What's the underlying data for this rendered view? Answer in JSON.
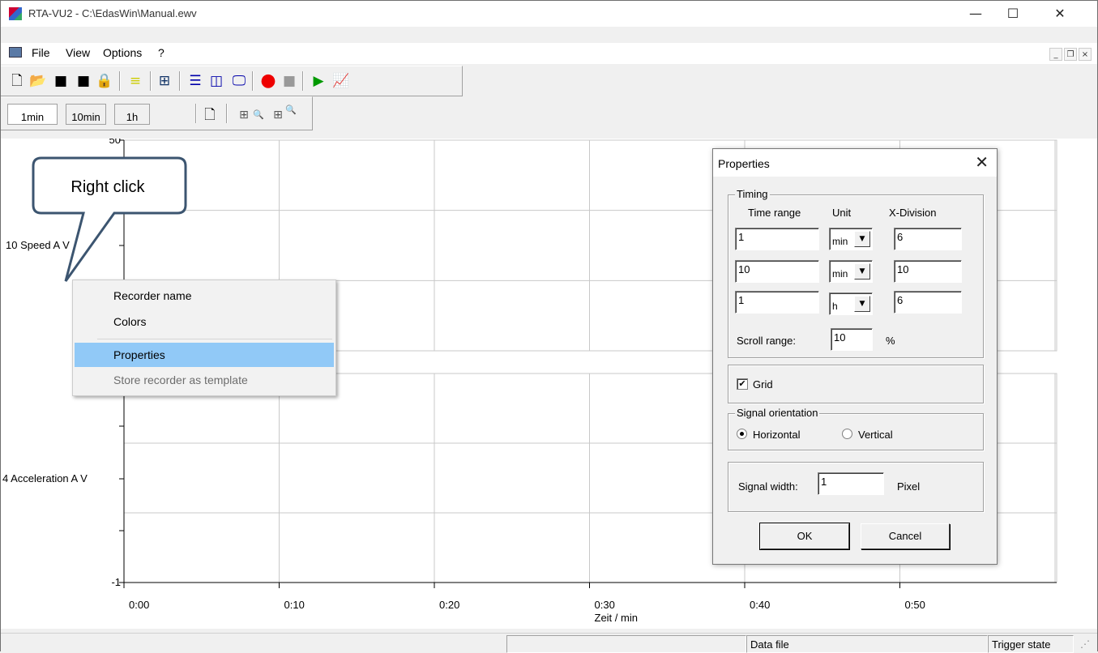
{
  "window": {
    "title": "RTA-VU2 - C:\\EdasWin\\Manual.ewv",
    "minimize": "—",
    "maximize": "☐",
    "close": "✕"
  },
  "menu": {
    "items": [
      "File",
      "View",
      "Options",
      "?"
    ],
    "mdi_minimize": "_",
    "mdi_restore": "❐",
    "mdi_close": "×"
  },
  "toolbar_icons": [
    "new-file-icon",
    "open-folder-icon",
    "save-icon",
    "save-as-icon",
    "lock-icon",
    "list-icon",
    "add-signal-icon",
    "horizontal-layout-icon",
    "vertical-layout-icon",
    "display-icon",
    "record-icon",
    "stop-icon",
    "start-icon",
    "chart-icon"
  ],
  "range_buttons": [
    "1min",
    "10min",
    "1h"
  ],
  "chart": {
    "y_top": "50",
    "y_bottom": "-1",
    "signal1_label": "10 Speed A V",
    "signal2_label": "4 Acceleration A V",
    "x_ticks": [
      "0:00",
      "0:10",
      "0:20",
      "0:30",
      "0:40",
      "0:50"
    ],
    "x_label": "Zeit / min"
  },
  "chart_data": {
    "type": "line",
    "x_ticks": [
      "0:00",
      "0:10",
      "0:20",
      "0:30",
      "0:40",
      "0:50"
    ],
    "xlabel": "Zeit / min",
    "y_top_label": "50",
    "y_bottom_label": "-1",
    "series": [
      {
        "name": "10 Speed A V",
        "values": []
      },
      {
        "name": "4 Acceleration A V",
        "values": []
      }
    ],
    "grid": true
  },
  "callout": {
    "text": "Right click"
  },
  "context_menu": {
    "items": [
      {
        "label": "Recorder name",
        "state": "normal"
      },
      {
        "label": "Colors",
        "state": "normal"
      },
      {
        "label": "Properties",
        "state": "selected"
      },
      {
        "label": "Store recorder as template",
        "state": "disabled"
      }
    ]
  },
  "dialog": {
    "title": "Properties",
    "timing_group": "Timing",
    "col_time_range": "Time range",
    "col_unit": "Unit",
    "col_xdivision": "X-Division",
    "rows": [
      {
        "time_range": "1",
        "unit": "min",
        "xdivision": "6"
      },
      {
        "time_range": "10",
        "unit": "min",
        "xdivision": "10"
      },
      {
        "time_range": "1",
        "unit": "h",
        "xdivision": "6"
      }
    ],
    "scroll_range_label": "Scroll range:",
    "scroll_range_value": "10",
    "scroll_range_unit": "%",
    "grid_label": "Grid",
    "grid_checked": "✔",
    "orientation_group": "Signal orientation",
    "horizontal_label": "Horizontal",
    "vertical_label": "Vertical",
    "signal_width_label": "Signal width:",
    "signal_width_value": "1",
    "signal_width_unit": "Pixel",
    "ok": "OK",
    "cancel": "Cancel"
  },
  "status": {
    "data_file": "Data file",
    "trigger_state": "Trigger state"
  }
}
